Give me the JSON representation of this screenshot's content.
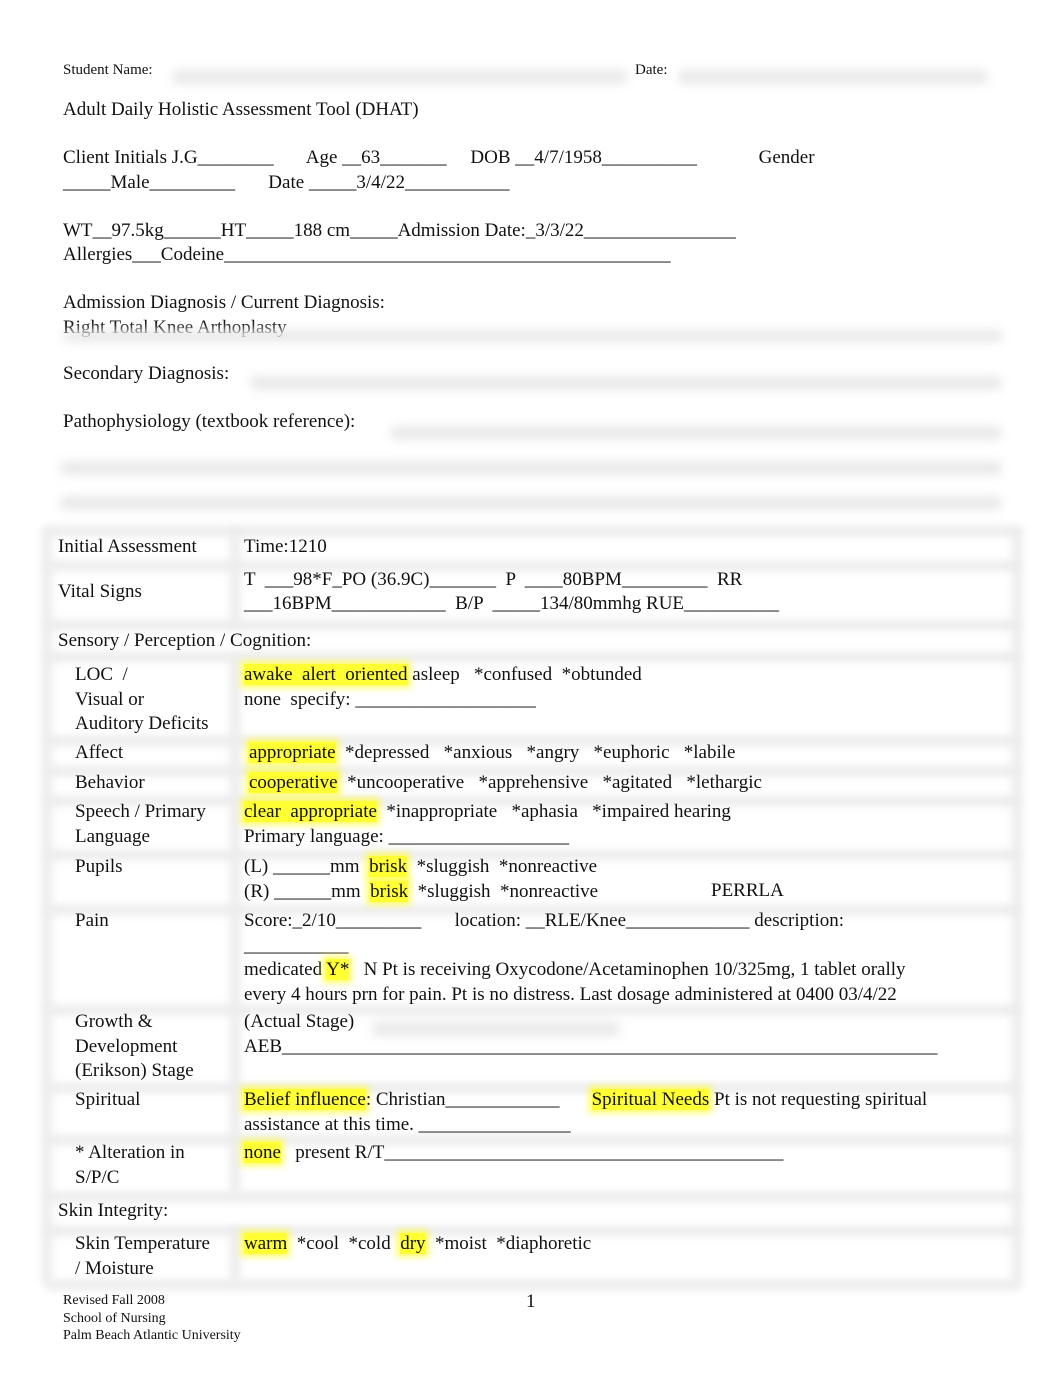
{
  "header": {
    "student_name_label": "Student Name:",
    "date_label": "Date:",
    "title": "Adult Daily Holistic Assessment Tool (DHAT)"
  },
  "client": {
    "line1": "Client Initials J.G________       Age __63_______     DOB __4/7/1958__________             Gender",
    "line2": "_____Male_________       Date _____3/4/22___________",
    "line3": "WT__97.5kg______HT_____188 cm_____Admission Date:_3/3/22________________",
    "line4": "Allergies___Codeine_______________________________________________",
    "initials": "J.G",
    "age": "63",
    "dob": "4/7/1958",
    "gender": "Male",
    "date": "3/4/22",
    "weight": "97.5kg",
    "height": "188 cm",
    "admission_date": "3/3/22",
    "allergies": "Codeine"
  },
  "diagnosis": {
    "admission_label": "Admission Diagnosis / Current Diagnosis:",
    "admission_value": "Right Total Knee Arthoplasty",
    "secondary_label": "Secondary Diagnosis:",
    "patho_label": "Pathophysiology (textbook reference):"
  },
  "table": {
    "initial": {
      "label": "Initial Assessment",
      "value": "Time:1210"
    },
    "vitals": {
      "label": "Vital Signs",
      "line1": "T  ___98*F_PO (36.9C)_______  P  ____80BPM_________  RR",
      "line2": "___16BPM____________  B/P  _____134/80mmhg RUE__________"
    },
    "spc_header": "Sensory / Perception / Cognition:",
    "loc": {
      "label1": "LOC  /",
      "label2": "Visual or",
      "label3": "Auditory Deficits",
      "selected": "awake  alert  oriented",
      "rest1": " asleep   *confused  *obtunded",
      "line2": "none  specify: ___________________"
    },
    "affect": {
      "label": "Affect",
      "selected": "appropriate",
      "rest": "  *depressed   *anxious   *angry   *euphoric   *labile"
    },
    "behavior": {
      "label": "Behavior",
      "selected": "cooperative",
      "rest": "  *uncooperative   *apprehensive   *agitated   *lethargic"
    },
    "speech": {
      "label1": "Speech / Primary",
      "label2": "Language",
      "selected": "clear  appropriate",
      "rest": "  *inappropriate   *aphasia   *impaired hearing",
      "line2": "Primary language: ___________________"
    },
    "pupils": {
      "label": "Pupils",
      "left_prefix": "(L) ______mm  ",
      "right_prefix": "(R) ______mm  ",
      "selected": "brisk",
      "rest": "  *sluggish  *nonreactive",
      "perrla": "PERRLA"
    },
    "pain": {
      "label": "Pain",
      "line1": "Score:_2/10_________       location: __RLE/Knee_____________ description:",
      "line2": "___________",
      "medicated_prefix": "medicated ",
      "medicated_selected": "Y*",
      "line3_rest": "   N Pt is receiving Oxycodone/Acetaminophen 10/325mg, 1 tablet orally",
      "line4": "every 4 hours prn for pain. Pt is no distress. Last dosage administered at 0400 03/4/22",
      "score": "2/10",
      "location": "RLE/Knee"
    },
    "growth": {
      "label1": "Growth &",
      "label2": "Development",
      "label3": "(Erikson) Stage",
      "line1": "(Actual Stage)",
      "line2": "AEB_____________________________________________________________________"
    },
    "spiritual": {
      "label": "Spiritual",
      "belief_label": "Belief influence",
      "belief_value": ": Christian____________",
      "needs_label": "Spiritual Needs",
      "needs_value": " Pt is not requesting spiritual",
      "line2": "assistance at this time. ________________"
    },
    "alteration": {
      "label1": "* Alteration in",
      "label2": "S/P/C",
      "selected": "none",
      "rest": "   present R/T__________________________________________"
    },
    "skin_header": "Skin Integrity:",
    "skin": {
      "label1": "Skin Temperature",
      "label2": "/ Moisture",
      "sel1": "warm",
      "mid": "  *cool  *cold  ",
      "sel2": "dry",
      "rest": "  *moist  *diaphoretic"
    }
  },
  "footer": {
    "line1": "Revised Fall 2008",
    "line2": "School of Nursing",
    "line3": "Palm Beach Atlantic University",
    "page_number": "1"
  },
  "colors": {
    "highlight": "#ffff33",
    "text": "#111111",
    "redaction": "#e9e9e9"
  }
}
